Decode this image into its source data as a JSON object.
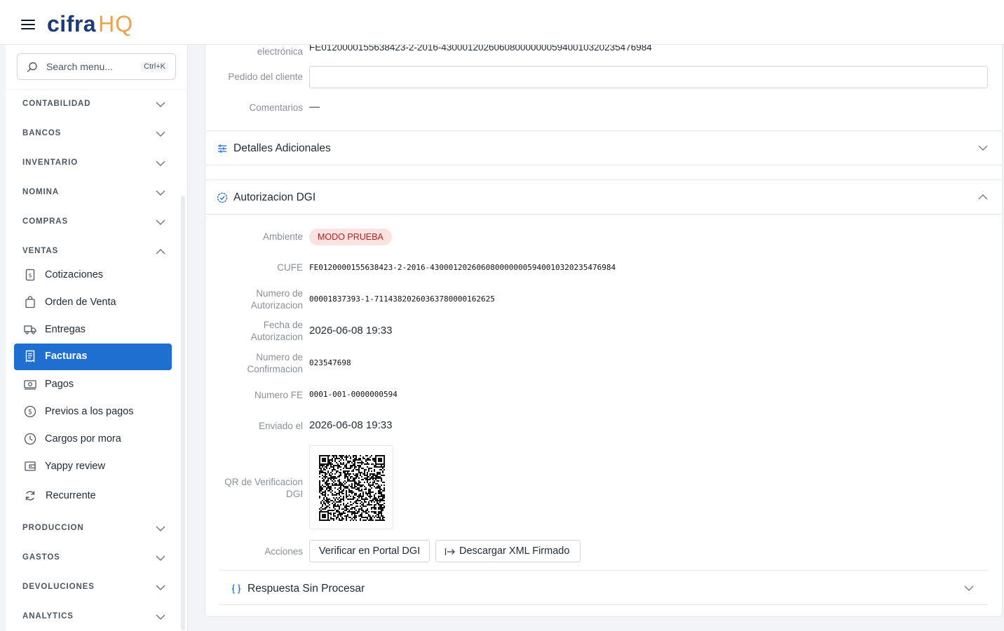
{
  "header": {
    "logo_primary": "cifra",
    "logo_secondary": "HQ"
  },
  "search": {
    "placeholder": "Search menu...",
    "shortcut": "Ctrl+K"
  },
  "sidebar": {
    "sections": [
      {
        "label": "CONTABILIDAD",
        "expanded": false
      },
      {
        "label": "BANCOS",
        "expanded": false
      },
      {
        "label": "INVENTARIO",
        "expanded": false
      },
      {
        "label": "NOMINA",
        "expanded": false
      },
      {
        "label": "COMPRAS",
        "expanded": false
      },
      {
        "label": "VENTAS",
        "expanded": true
      },
      {
        "label": "PRODUCCION",
        "expanded": false
      },
      {
        "label": "GASTOS",
        "expanded": false
      },
      {
        "label": "DEVOLUCIONES",
        "expanded": false
      },
      {
        "label": "ANALYTICS",
        "expanded": false
      }
    ],
    "ventas_items": [
      {
        "label": "Cotizaciones",
        "icon": "document-dollar-icon"
      },
      {
        "label": "Orden de Venta",
        "icon": "shopping-bag-icon"
      },
      {
        "label": "Entregas",
        "icon": "truck-icon"
      },
      {
        "label": "Facturas",
        "icon": "receipt-icon",
        "active": true
      },
      {
        "label": "Pagos",
        "icon": "cash-icon"
      },
      {
        "label": "Previos a los pagos",
        "icon": "dollar-circle-icon"
      },
      {
        "label": "Cargos por mora",
        "icon": "clock-icon"
      },
      {
        "label": "Yappy review",
        "icon": "wallet-icon"
      },
      {
        "label": "Recurrente",
        "icon": "refresh-icon"
      }
    ]
  },
  "main": {
    "top": {
      "factura_label": "electrónica",
      "factura_value": "FE0120000155638423-2-2016-430001202606080000000594001032023547698​4",
      "pedido_label": "Pedido del cliente",
      "pedido_value": "",
      "comentarios_label": "Comentarios",
      "comentarios_value": "—"
    },
    "detalles": {
      "title": "Detalles Adicionales",
      "expanded": false
    },
    "autorizacion": {
      "title": "Autorizacion DGI",
      "expanded": true,
      "ambiente_label": "Ambiente",
      "ambiente_value": "MODO PRUEBA",
      "cufe_label": "CUFE",
      "cufe_value": "FE0120000155638423-2-2016-4300012026060800000005940010320235476984",
      "num_aut_label_1": "Numero de",
      "num_aut_label_2": "Autorizacion",
      "num_aut_value": "00001837393-1-71143820260363780000162625",
      "fecha_label_1": "Fecha de",
      "fecha_label_2": "Autorizacion",
      "fecha_value": "2026-06-08 19:33",
      "num_conf_label_1": "Numero de",
      "num_conf_label_2": "Confirmacion",
      "num_conf_value": "023547698",
      "num_fe_label": "Numero FE",
      "num_fe_value": "0001-001-0000000594",
      "enviado_label": "Enviado el",
      "enviado_value": "2026-06-08 19:33",
      "qr_label_1": "QR de Verificacion",
      "qr_label_2": "DGI",
      "acciones_label": "Acciones",
      "verificar_button": "Verificar en Portal DGI",
      "descargar_button": "Descargar XML Firmado"
    },
    "respuesta": {
      "title": "Respuesta Sin Procesar",
      "expanded": false
    }
  },
  "colors": {
    "brand_dark": "#1d3a7a",
    "brand_accent": "#f0a04b",
    "active": "#1f6fd1",
    "badge_bg": "#fde2e2",
    "badge_text": "#b91c1c"
  }
}
